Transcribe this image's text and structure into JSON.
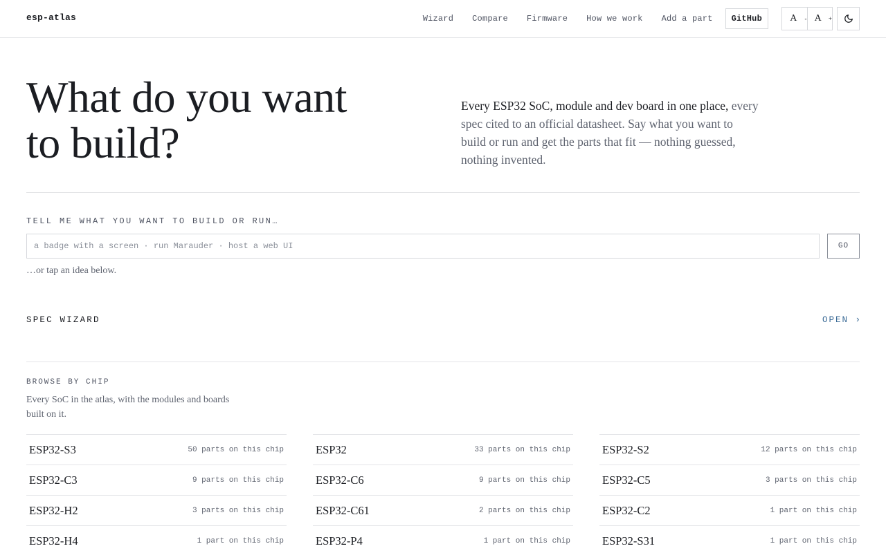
{
  "brand": {
    "name": "esp-atlas"
  },
  "nav": {
    "items": [
      "Wizard",
      "Compare",
      "Firmware",
      "How we work",
      "Add a part"
    ],
    "github": "GitHub"
  },
  "font_controls": {
    "decrease": "A",
    "decrease_sign": "-",
    "increase": "A",
    "increase_sign": "+"
  },
  "theme_toggle": {
    "icon": "moon-icon"
  },
  "hero": {
    "title": "What do you want to build?",
    "lead": "Every ESP32 SoC, module and dev board in one place,",
    "body": "every spec cited to an official datasheet. Say what you want to build or run and get the parts that fit — nothing guessed, nothing invented."
  },
  "ask": {
    "label": "TELL ME WHAT YOU WANT TO BUILD OR RUN…",
    "placeholder": "a badge with a screen · run Marauder · host a web UI",
    "value": "",
    "button": "GO",
    "hint": "…or tap an idea below."
  },
  "wizard": {
    "label": "SPEC WIZARD",
    "open": "OPEN ›"
  },
  "browse": {
    "label": "BROWSE BY CHIP",
    "description": "Every SoC in the atlas, with the modules and boards built on it.",
    "chips": [
      {
        "name": "ESP32-S3",
        "count": "50 parts on this chip"
      },
      {
        "name": "ESP32",
        "count": "33 parts on this chip"
      },
      {
        "name": "ESP32-S2",
        "count": "12 parts on this chip"
      },
      {
        "name": "ESP32-C3",
        "count": "9 parts on this chip"
      },
      {
        "name": "ESP32-C6",
        "count": "9 parts on this chip"
      },
      {
        "name": "ESP32-C5",
        "count": "3 parts on this chip"
      },
      {
        "name": "ESP32-H2",
        "count": "3 parts on this chip"
      },
      {
        "name": "ESP32-C61",
        "count": "2 parts on this chip"
      },
      {
        "name": "ESP32-C2",
        "count": "1 part on this chip"
      },
      {
        "name": "ESP32-H4",
        "count": "1 part on this chip"
      },
      {
        "name": "ESP32-P4",
        "count": "1 part on this chip"
      },
      {
        "name": "ESP32-S31",
        "count": "1 part on this chip"
      }
    ]
  },
  "colors": {
    "text": "#1b1d22",
    "muted": "#5f6470",
    "accent": "#3a6a96",
    "border": "#e3e4e7"
  }
}
